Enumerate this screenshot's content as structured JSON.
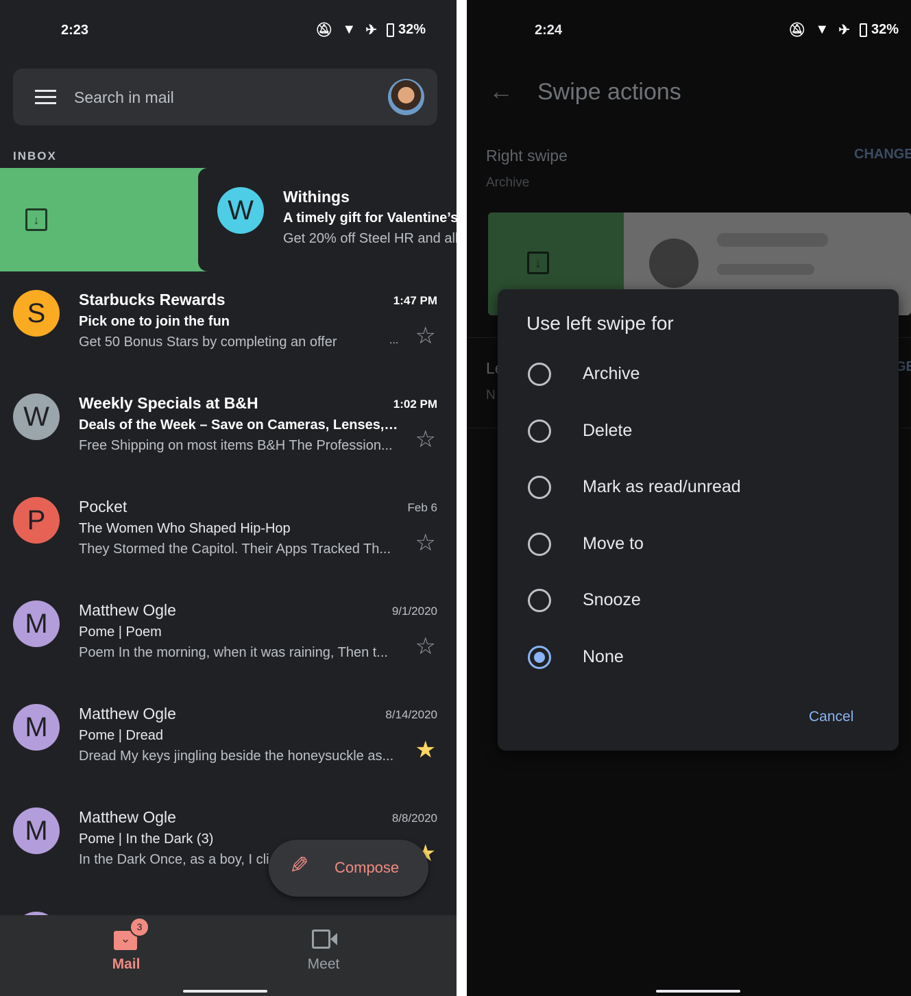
{
  "left": {
    "status": {
      "time": "2:23",
      "battery": "32%"
    },
    "search": {
      "placeholder": "Search in mail"
    },
    "section": "INBOX",
    "swiped": {
      "initial": "W",
      "color": "#4ecde6",
      "name": "Withings",
      "subject": "A timely gift for Valentine’s",
      "snippet": "Get 20% off Steel HR and all",
      "swipe_color": "#5bb974",
      "swipe_icon": "archive-icon"
    },
    "emails": [
      {
        "initial": "S",
        "color": "#fbab22",
        "name": "Starbucks Rewards",
        "subject": "Pick one to join the fun",
        "snippet": "Get 50 Bonus Stars by completing an offer",
        "time": "1:47 PM",
        "unread": true,
        "starred": false,
        "more": "..."
      },
      {
        "initial": "W",
        "color": "#9aa5ac",
        "name": "Weekly Specials at B&H",
        "subject": "Deals of the Week – Save on Cameras, Lenses, C...",
        "snippet": "Free Shipping on most items B&H The Profession...",
        "time": "1:02 PM",
        "unread": true,
        "starred": false
      },
      {
        "initial": "P",
        "color": "#e66255",
        "name": "Pocket",
        "subject": "The Women Who Shaped Hip-Hop",
        "snippet": "They Stormed the Capitol. Their Apps Tracked Th...",
        "time": "Feb 6",
        "unread": false,
        "starred": false
      },
      {
        "initial": "M",
        "color": "#b39ddb",
        "name": "Matthew Ogle",
        "subject": "Pome | Poem",
        "snippet": "Poem In the morning, when it was raining, Then t...",
        "time": "9/1/2020",
        "unread": false,
        "starred": false
      },
      {
        "initial": "M",
        "color": "#b39ddb",
        "name": "Matthew Ogle",
        "subject": "Pome | Dread",
        "snippet": "Dread My keys jingling beside the honeysuckle as...",
        "time": "8/14/2020",
        "unread": false,
        "starred": true
      },
      {
        "initial": "M",
        "color": "#b39ddb",
        "name": "Matthew Ogle",
        "subject": "Pome | In the Dark (3)",
        "snippet": "In the Dark Once, as a boy, I cli",
        "time": "8/8/2020",
        "unread": false,
        "starred": true
      }
    ],
    "compose": "Compose",
    "nav": {
      "mail": "Mail",
      "mail_badge": "3",
      "meet": "Meet"
    },
    "accent": "#f28b82"
  },
  "right": {
    "status": {
      "time": "2:24",
      "battery": "32%"
    },
    "title": "Swipe actions",
    "right_swipe": {
      "label": "Right swipe",
      "value": "Archive",
      "change": "CHANGE"
    },
    "left_swipe": {
      "label": "Le",
      "value": "N",
      "change": "GE"
    },
    "dialog": {
      "title": "Use left swipe for",
      "options": [
        "Archive",
        "Delete",
        "Mark as read/unread",
        "Move to",
        "Snooze",
        "None"
      ],
      "selected": "None",
      "cancel": "Cancel"
    },
    "accent": "#8ab4f8"
  }
}
